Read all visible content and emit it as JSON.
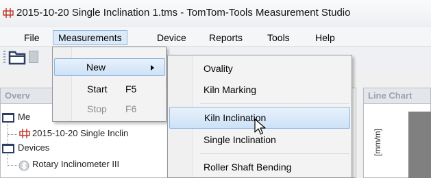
{
  "window": {
    "title": "2015-10-20 Single Inclination 1.tms - TomTom-Tools Measurement Studio",
    "icon": "tms-file-icon"
  },
  "menubar": {
    "items": [
      {
        "label": "File"
      },
      {
        "label": "Measurements"
      },
      {
        "label": "Device"
      },
      {
        "label": "Reports"
      },
      {
        "label": "Tools"
      },
      {
        "label": "Help"
      }
    ]
  },
  "measurements_menu": {
    "items": [
      {
        "label": "New",
        "shortcut": "",
        "enabled": true,
        "submenu": true
      },
      {
        "label": "Start",
        "shortcut": "F5",
        "enabled": true
      },
      {
        "label": "Stop",
        "shortcut": "F6",
        "enabled": false
      }
    ]
  },
  "new_submenu": {
    "items": [
      {
        "label": "Ovality"
      },
      {
        "label": "Kiln Marking"
      },
      {
        "label": "Kiln Inclination"
      },
      {
        "label": "Single Inclination"
      },
      {
        "label": "Roller Shaft Bending"
      }
    ],
    "highlighted": "Kiln Inclination"
  },
  "overview_panel": {
    "header": "Overv",
    "tree": [
      {
        "label": "Me",
        "icon": "folder-icon"
      },
      {
        "label": "2015-10-20 Single Inclin",
        "icon": "tms-file-icon"
      },
      {
        "label": "Devices",
        "icon": "folder-icon"
      },
      {
        "label": "Rotary Inclinometer III",
        "icon": "bluetooth-icon"
      }
    ]
  },
  "chart_panel": {
    "header": "Line Chart",
    "ylabel": "[mm/m]"
  },
  "colors": {
    "highlight": "#cde2f7",
    "highlight_border": "#8fb5e0",
    "folder": "#2c3e63",
    "tms_icon": "#c0392b"
  }
}
